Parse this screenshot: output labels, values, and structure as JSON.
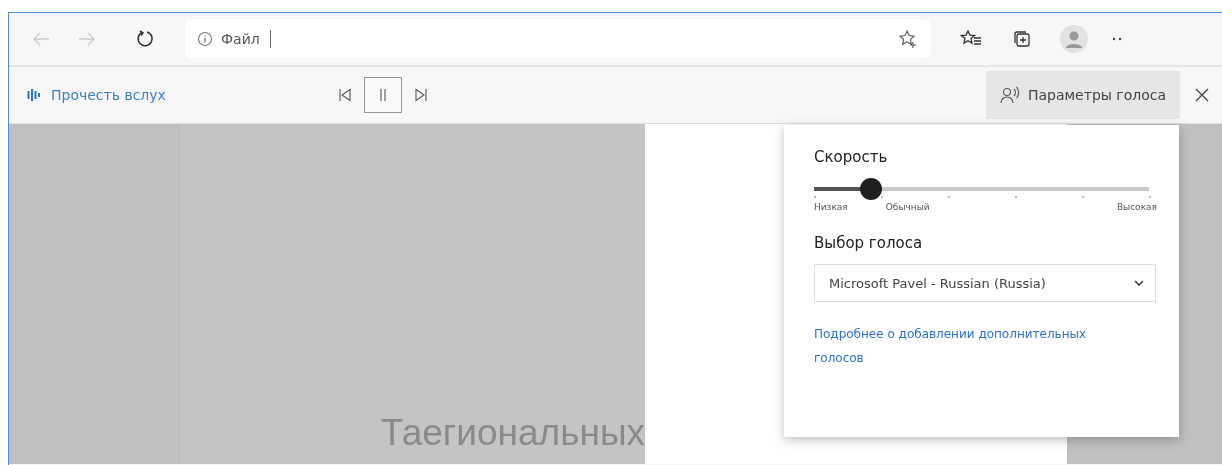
{
  "toolbar": {
    "address": "Файл"
  },
  "read_aloud": {
    "label": "Прочесть вслух",
    "playing": true,
    "voice_options": {
      "label": "Параметры голоса",
      "selected": true
    }
  },
  "voice_panel": {
    "speed_title": "Скорость",
    "speed": {
      "level": 0.17,
      "labels": [
        "Низкая",
        "Обычный",
        "Высокая"
      ]
    },
    "voice_title": "Выбор голоса",
    "voice": "Microsoft Pavel - Russian (Russia)",
    "link": "Подробнее о добавлении дополнительных голосов"
  },
  "page": {
    "text": "Таегиональных"
  }
}
